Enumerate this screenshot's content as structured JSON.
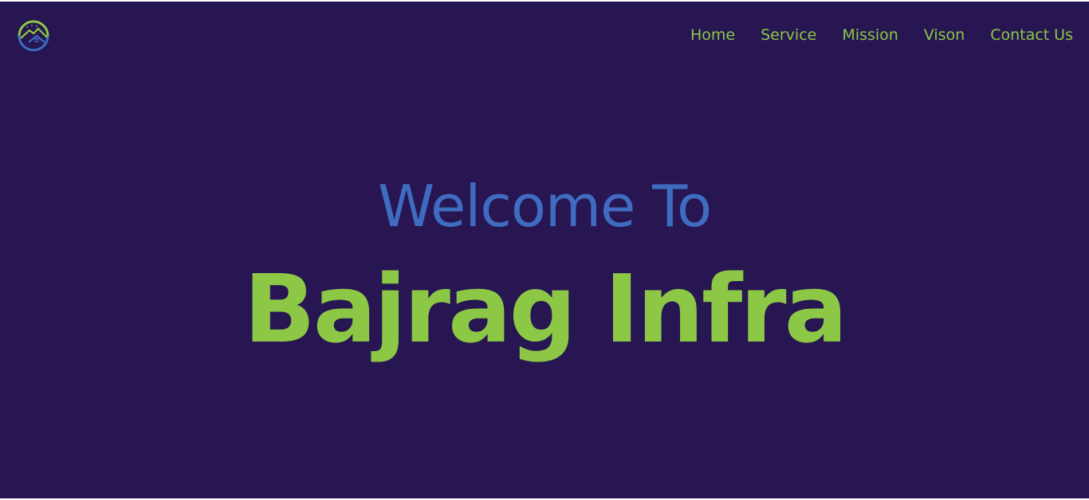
{
  "brand": {
    "logo_icon": "house-roof-circle-logo-icon",
    "colors": {
      "background": "#271652",
      "accent_green": "#8cc846",
      "accent_blue": "#3f6cc0"
    }
  },
  "nav": {
    "items": [
      {
        "label": "Home"
      },
      {
        "label": "Service"
      },
      {
        "label": "Mission"
      },
      {
        "label": "Vison"
      },
      {
        "label": "Contact Us"
      }
    ]
  },
  "hero": {
    "greeting": "Welcome To",
    "title": "Bajrag Infra"
  }
}
